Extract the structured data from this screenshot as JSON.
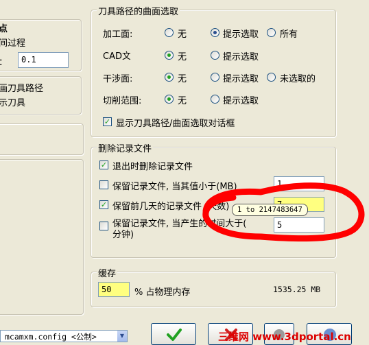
{
  "left": {
    "label_point": "点",
    "label_process": "间过程",
    "label_tolerance": "：",
    "tolerance_value": "0.1",
    "label_toolpath": "画刀具路径",
    "label_showtool": "示刀具"
  },
  "surface_select": {
    "title": "刀具路径的曲面选取",
    "rows": [
      {
        "label": "加工面:",
        "options": [
          "无",
          "提示选取",
          "所有"
        ],
        "selected": 1
      },
      {
        "label": "CAD文件:",
        "options": [
          "无",
          "提示选取"
        ],
        "selected": 0
      },
      {
        "label": "干涉面:",
        "options": [
          "无",
          "提示选取",
          "未选取的"
        ],
        "selected": 0
      },
      {
        "label": "切削范围:",
        "options": [
          "无",
          "提示选取"
        ],
        "selected": 0
      }
    ],
    "show_dialog_label": "显示刀具路径/曲面选取对话框",
    "show_dialog_checked": true
  },
  "delete_log": {
    "title": "删除记录文件",
    "delete_on_exit_label": "退出时删除记录文件",
    "keep_if_less_label": "保留记录文件, 当其值小于(MB)",
    "keep_if_less_value": "1",
    "keep_days_label": "保留前几天的记录文件 (天数)",
    "keep_days_value": "7",
    "keep_if_time_label": "保留记录文件, 当产生的时间大于(",
    "keep_if_time_label2": "分钟)",
    "keep_if_time_value": "5",
    "tooltip": "1 to 2147483647"
  },
  "cache": {
    "title": "缓存",
    "value": "50",
    "percent_label": "% 占物理内存",
    "memory": "1535.25 MB"
  },
  "bottom": {
    "config_select": "mcamxm.config <公制>"
  },
  "watermark": "三维网 www.3dportal.cn",
  "colors": {
    "annotation_red": "#ff0000",
    "checkmark_green": "#21a121",
    "field_yellow": "#ffff80"
  },
  "icons": {
    "ok": "check-icon",
    "cancel": "x-icon",
    "help": "help-icon"
  }
}
